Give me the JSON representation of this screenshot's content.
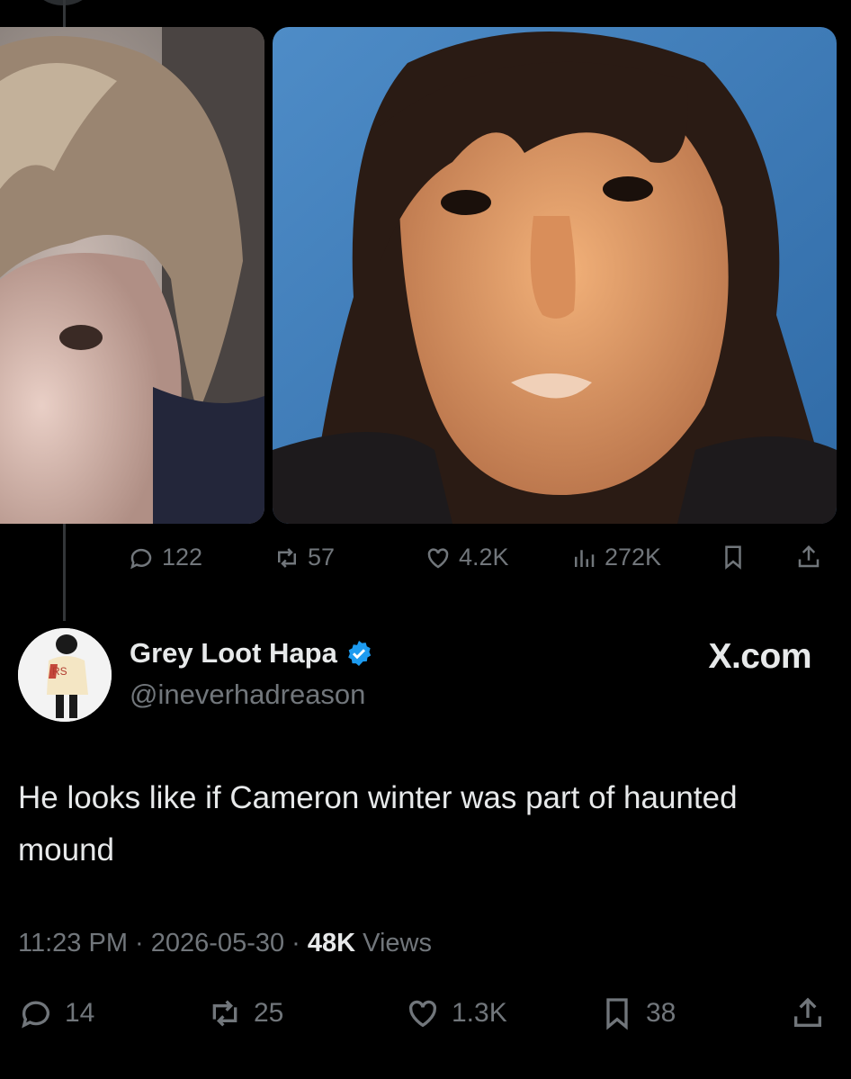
{
  "previous_tweet": {
    "stats": {
      "replies": "122",
      "reposts": "57",
      "likes": "4.2K",
      "views": "272K"
    }
  },
  "tweet": {
    "author_name": "Grey Loot Hapa",
    "handle": "@ineverhadreason",
    "verified": true,
    "text": "He looks like if Cameron winter was part of haunted mound",
    "time": "11:23 PM",
    "date": "2026-05-30",
    "views_count": "48K",
    "views_label": "Views",
    "stats": {
      "replies": "14",
      "reposts": "25",
      "likes": "1.3K",
      "bookmarks": "38"
    }
  },
  "watermark": {
    "brand": "X.com"
  },
  "colors": {
    "background": "#000000",
    "text": "#e7e9ea",
    "muted": "#71767b",
    "verified": "#1d9bf0"
  }
}
